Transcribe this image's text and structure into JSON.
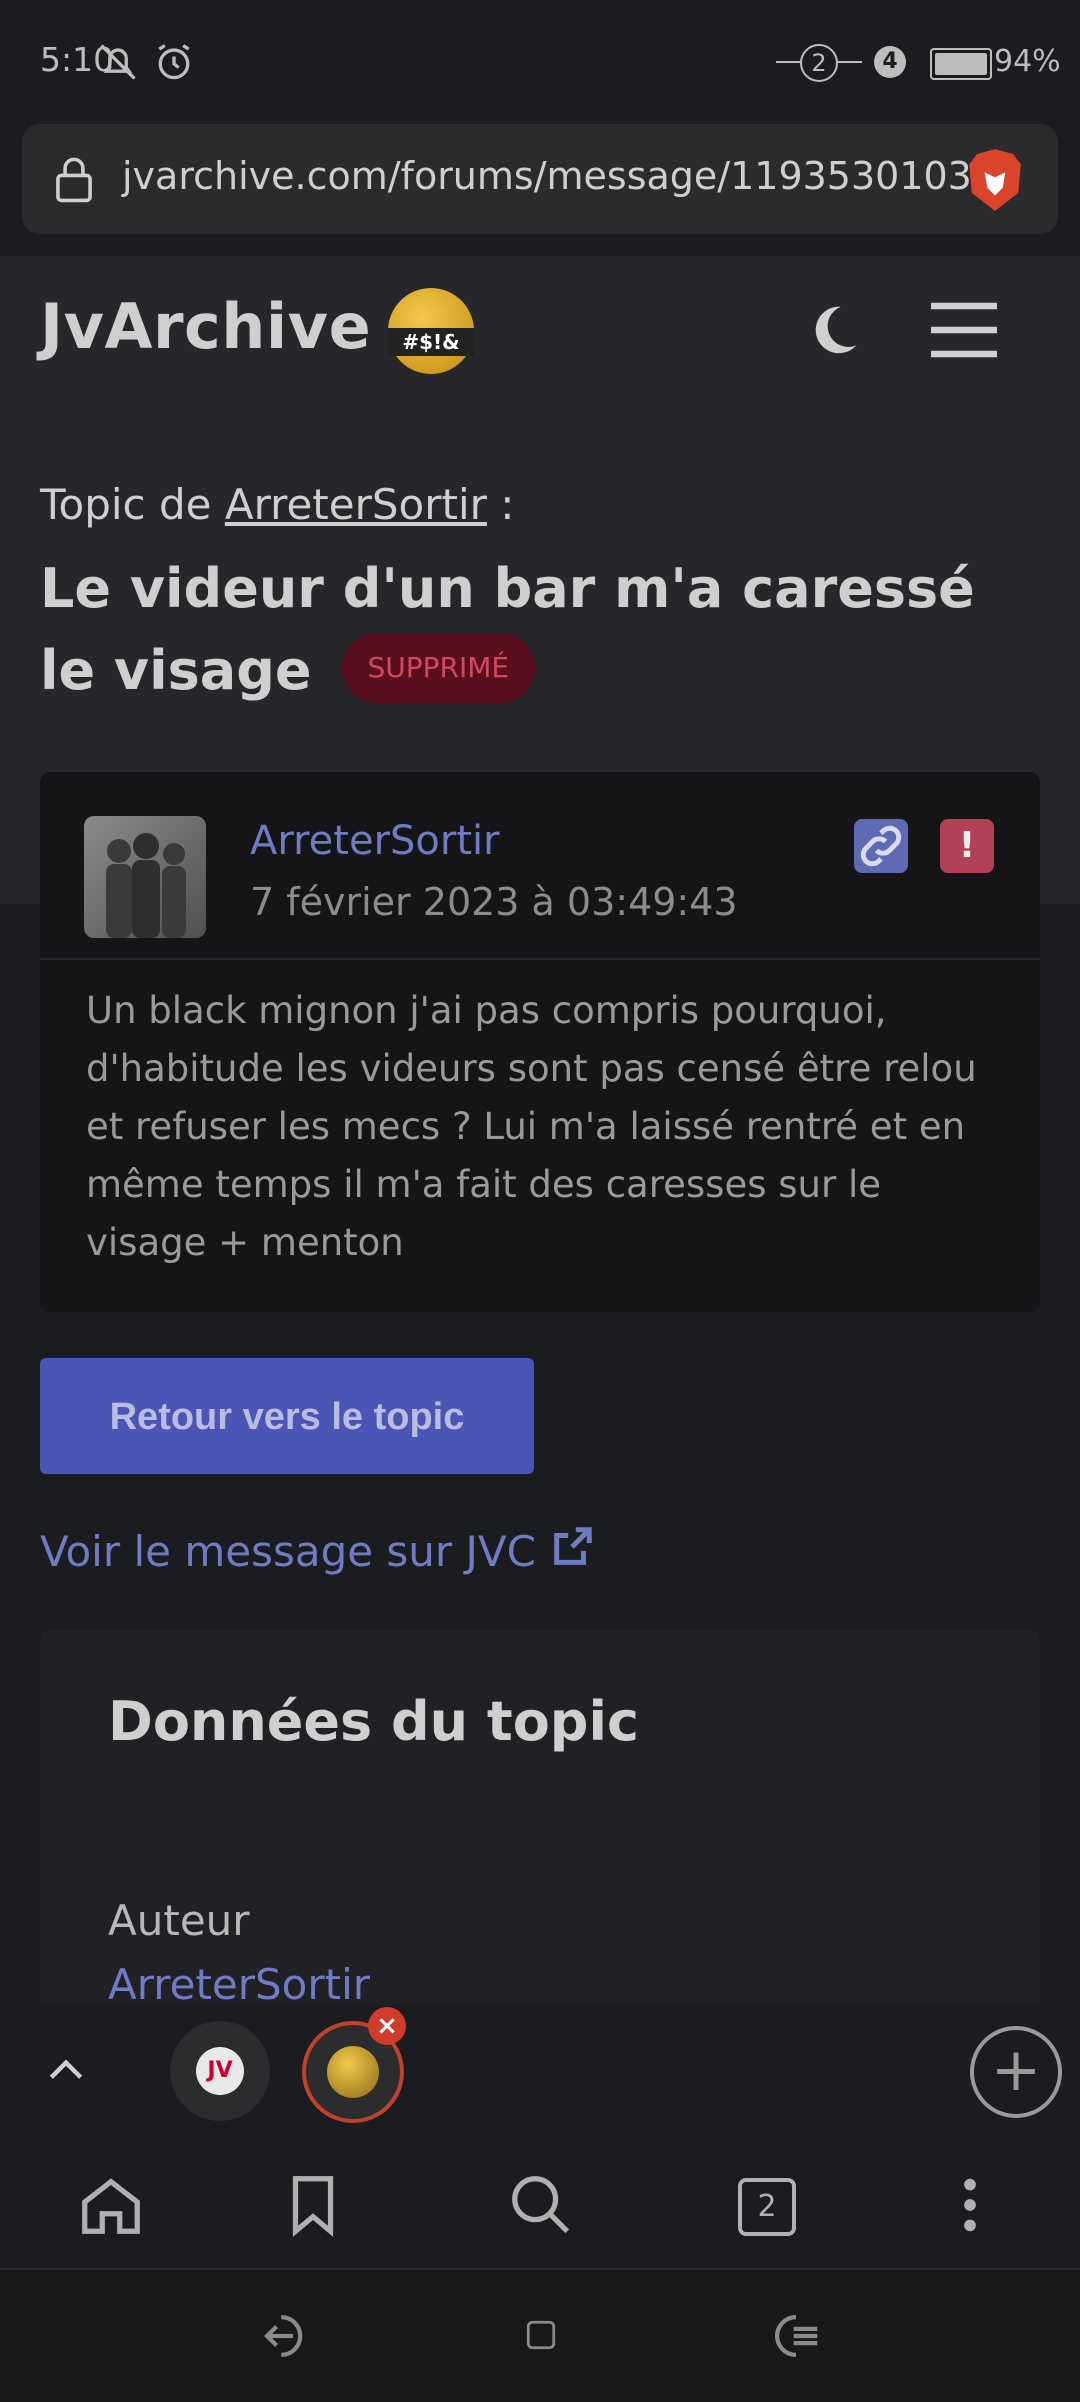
{
  "status_bar": {
    "time": "5:10",
    "sim_badge": "2",
    "notif_badge": "4",
    "battery": "94%"
  },
  "browser": {
    "url": "jvarchive.com/forums/message/1193530103",
    "tab_count": "2",
    "new_tab_label": "+"
  },
  "site": {
    "logo": "JvArchive",
    "emoji_text": "#$!&"
  },
  "topic": {
    "prefix": "Topic de",
    "author": "ArreterSortir",
    "separator": ":",
    "title": "Le videur d'un bar m'a caressé le visage",
    "badge": "SUPPRIMÉ"
  },
  "message": {
    "author": "ArreterSortir",
    "date": "7 février 2023 à 03:49:43",
    "body": "Un black mignon j'ai pas compris pourquoi, d'habitude les videurs sont pas censé être relou et refuser les mecs ? Lui m'a laissé rentré et en même temps il m'a fait des caresses sur le visage + menton",
    "report_symbol": "!"
  },
  "actions": {
    "back_button": "Retour vers le topic",
    "jvc_link": "Voir le message sur JVC"
  },
  "topic_data": {
    "title": "Données du topic",
    "author_label": "Auteur",
    "author_value": "ArreterSortir"
  },
  "tabs": {
    "tab1_icon_text": "JV",
    "tab2_close": "×"
  },
  "colors": {
    "accent": "#6f7bc2",
    "button": "#4a55b5",
    "danger_badge": "#5a0f1e",
    "brave": "#d9442b"
  },
  "icons": [
    "alarm-off-icon",
    "alarm-icon",
    "lock-icon",
    "brave-lion-icon",
    "moon-icon",
    "hamburger-menu-icon",
    "link-icon",
    "external-link-icon",
    "chevron-up-icon",
    "home-icon",
    "bookmark-icon",
    "search-icon",
    "more-vert-icon",
    "back-nav-icon",
    "recents-nav-icon",
    "home-nav-icon"
  ]
}
